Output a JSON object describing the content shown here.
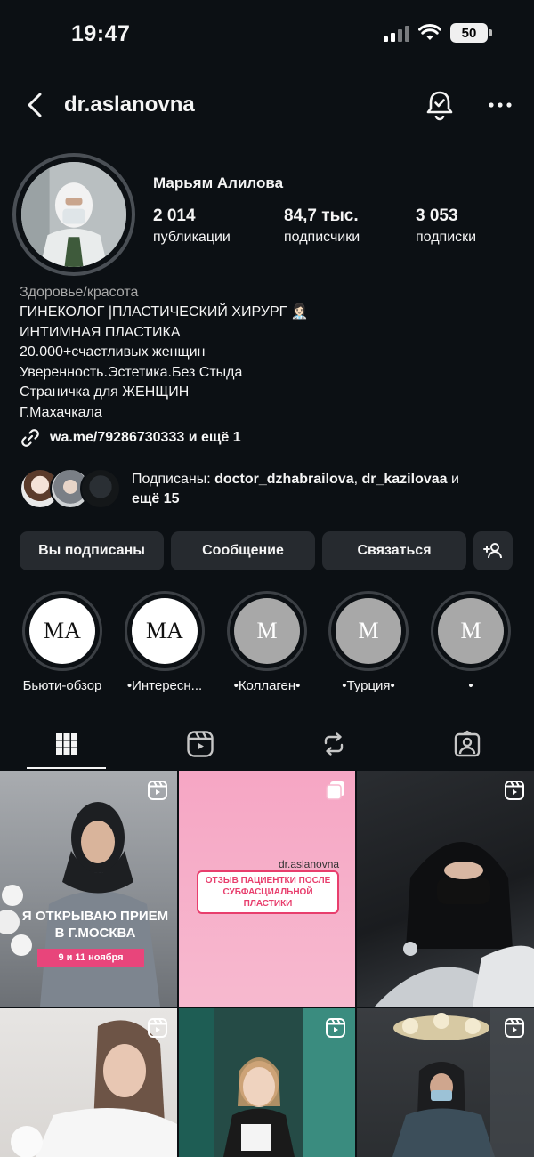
{
  "status": {
    "time": "19:47",
    "battery": "50"
  },
  "header": {
    "username": "dr.aslanovna"
  },
  "profile": {
    "full_name": "Марьям Алилова",
    "stats": [
      {
        "value": "2 014",
        "label": "публикации"
      },
      {
        "value": "84,7 тыс.",
        "label": "подписчики"
      },
      {
        "value": "3 053",
        "label": "подписки"
      }
    ],
    "category": "Здоровье/красота",
    "bio_lines": [
      "ГИНЕКОЛОГ |ПЛАСТИЧЕСКИЙ ХИРУРГ 👩🏻‍⚕️",
      "ИНТИМНАЯ ПЛАСТИКА",
      "20.000+счастливых женщин",
      "Уверенность.Эстетика.Без Стыда",
      "Страничка для ЖЕНЩИН",
      "Г.Махачкала"
    ],
    "link": "wa.me/79286730333 и ещё 1"
  },
  "followed_by": {
    "prefix": "Подписаны: ",
    "user1": "doctor_dzhabrailova",
    "sep": ", ",
    "user2": "dr_kazilovaa",
    "and": " и",
    "more": "ещё 15"
  },
  "actions": {
    "following": "Вы подписаны",
    "message": "Сообщение",
    "contact": "Связаться"
  },
  "highlights": [
    {
      "label": "Бьюти-обзор",
      "logo": "MA"
    },
    {
      "label": "•Интересн...",
      "logo": "MA"
    },
    {
      "label": "•Коллаген•",
      "logo": "M"
    },
    {
      "label": "•Турция•",
      "logo": "M"
    },
    {
      "label": "•",
      "logo": "M"
    }
  ],
  "posts": {
    "post1_title": "Я открываю прием в г.Москва",
    "post1_date": "9 и 11 ноября",
    "post2_handle": "dr.aslanovna",
    "post2_banner": "ОТЗЫВ ПАЦИЕНТКИ ПОСЛЕ СУБФАСЦИАЛЬНОЙ ПЛАСТИКИ"
  },
  "icons": {
    "back": "chevron-left-icon",
    "bell": "notification-bell-icon",
    "more": "more-horizontal-icon",
    "link": "link-icon",
    "add_user": "add-user-icon",
    "grid": "grid-icon",
    "reels": "reels-icon",
    "reposts": "repost-icon",
    "tagged": "tagged-icon"
  },
  "colors": {
    "background": "#0c1014",
    "button": "#262a2f",
    "text": "#f5f5f5",
    "muted": "#a8a8a8",
    "accent_pink": "#e8457b"
  }
}
